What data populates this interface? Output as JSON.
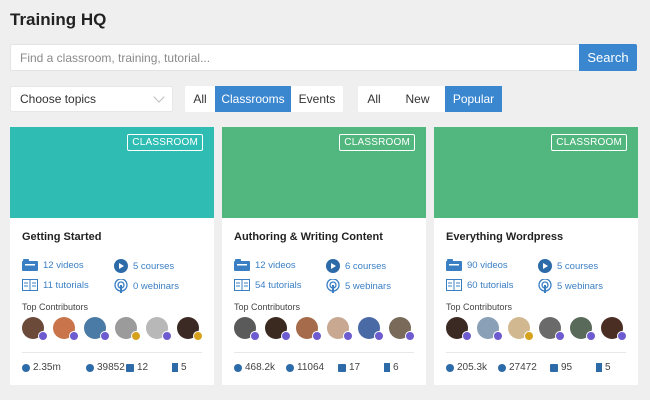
{
  "header": {
    "title": "Training HQ"
  },
  "search": {
    "placeholder": "Find a classroom, training, tutorial...",
    "button_label": "Search"
  },
  "filters": {
    "topics_label": "Choose topics",
    "type_tabs": [
      {
        "label": "All",
        "active": false
      },
      {
        "label": "Classrooms",
        "active": true
      },
      {
        "label": "Events",
        "active": false
      }
    ],
    "sort_tabs": [
      {
        "label": "All",
        "active": false
      },
      {
        "label": "New",
        "active": false
      },
      {
        "label": "Popular",
        "active": true
      }
    ]
  },
  "colors": {
    "accent": "#3a87d0",
    "teal": "#2fbdb3",
    "green": "#52b77e",
    "link": "#3a7fc4"
  },
  "cards": [
    {
      "badge": "CLASSROOM",
      "title": "Getting Started",
      "banner_color": "#2fbdb3",
      "videos": "12 videos",
      "courses": "5 courses",
      "tutorials": "11 tutorials",
      "webinars": "0 webinars",
      "contributors_label": "Top Contributors",
      "comments": "2.35m",
      "questions": "39852",
      "mail": "12",
      "bookmarks": "5"
    },
    {
      "badge": "CLASSROOM",
      "title": "Authoring & Writing Content",
      "banner_color": "#52b77e",
      "videos": "12 videos",
      "courses": "6 courses",
      "tutorials": "54 tutorials",
      "webinars": "5 webinars",
      "contributors_label": "Top Contributors",
      "comments": "468.2k",
      "questions": "11064",
      "mail": "17",
      "bookmarks": "6"
    },
    {
      "badge": "CLASSROOM",
      "title": "Everything Wordpress",
      "banner_color": "#52b77e",
      "videos": "90 videos",
      "courses": "5 courses",
      "tutorials": "60 tutorials",
      "webinars": "5 webinars",
      "contributors_label": "Top Contributors",
      "comments": "205.3k",
      "questions": "27472",
      "mail": "95",
      "bookmarks": "5"
    }
  ]
}
